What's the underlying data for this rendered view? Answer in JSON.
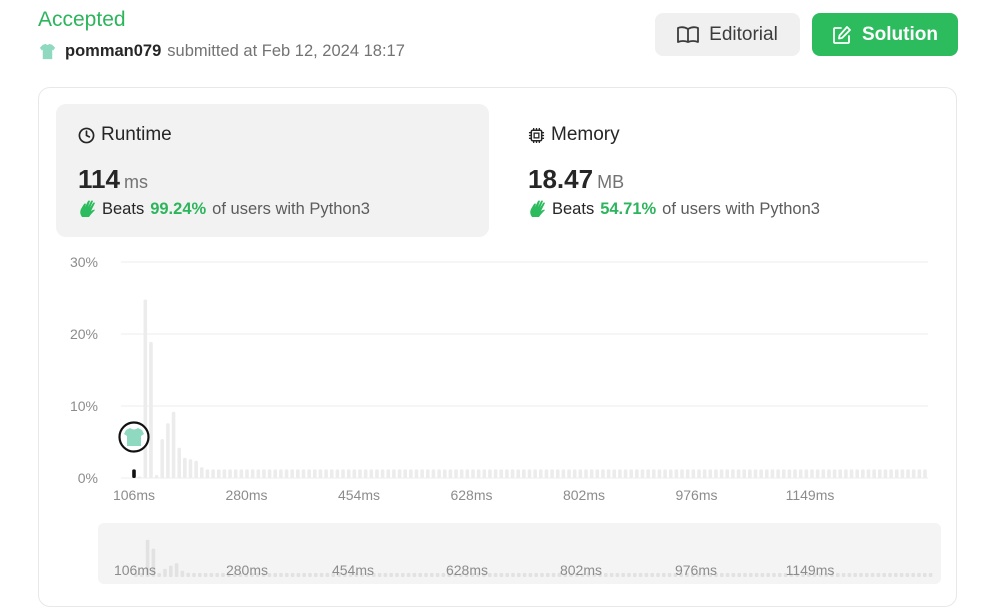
{
  "header": {
    "status": "Accepted",
    "username": "pomman079",
    "submitted_text": "submitted at Feb 12, 2024 18:17",
    "editorial_label": "Editorial",
    "solution_label": "Solution"
  },
  "runtime": {
    "title": "Runtime",
    "value": "114",
    "unit": "ms",
    "beats_label": "Beats",
    "beats_pct": "99.24%",
    "beats_suffix": "of users with Python3"
  },
  "memory": {
    "title": "Memory",
    "value": "18.47",
    "unit": "MB",
    "beats_label": "Beats",
    "beats_pct": "54.71%",
    "beats_suffix": "of users with Python3"
  },
  "colors": {
    "accent_green": "#2cbb5d",
    "bar_gray": "#ececec",
    "marker": "#000000",
    "avatar": "#8fd9c0"
  },
  "chart_data": {
    "type": "bar",
    "title": "",
    "xlabel": "",
    "ylabel": "",
    "ylim": [
      0,
      30
    ],
    "y_ticks": [
      "30%",
      "20%",
      "10%",
      "0%"
    ],
    "x_tick_labels": [
      "106ms",
      "280ms",
      "454ms",
      "628ms",
      "802ms",
      "976ms",
      "1149ms"
    ],
    "x_start_ms": 106,
    "x_step_ms": 5.8,
    "values": [
      1.2,
      0.2,
      24.8,
      18.9,
      0.4,
      5.4,
      7.6,
      9.2,
      4.2,
      2.8,
      2.6,
      2.4,
      1.5,
      1.2,
      1.2,
      1.2,
      1.2,
      1.2,
      1.2,
      1.2,
      1.2,
      1.2,
      1.2,
      1.2,
      1.2,
      1.2,
      1.2,
      1.2,
      1.2,
      1.2,
      1.2,
      1.2,
      1.2,
      1.2,
      1.2,
      1.2,
      1.2,
      1.2,
      1.2,
      1.2,
      1.2,
      1.2,
      1.2,
      1.2,
      1.2,
      1.2,
      1.2,
      1.2,
      1.2,
      1.2,
      1.2,
      1.2,
      1.2,
      1.2,
      1.2,
      1.2,
      1.2,
      1.2,
      1.2,
      1.2,
      1.2,
      1.2,
      1.2,
      1.2,
      1.2,
      1.2,
      1.2,
      1.2,
      1.2,
      1.2,
      1.2,
      1.2,
      1.2,
      1.2,
      1.2,
      1.2,
      1.2,
      1.2,
      1.2,
      1.2,
      1.2,
      1.2,
      1.2,
      1.2,
      1.2,
      1.2,
      1.2,
      1.2,
      1.2,
      1.2,
      1.2,
      1.2,
      1.2,
      1.2,
      1.2,
      1.2,
      1.2,
      1.2,
      1.2,
      1.2,
      1.2,
      1.2,
      1.2,
      1.2,
      1.2,
      1.2,
      1.2,
      1.2,
      1.2,
      1.2,
      1.2,
      1.2,
      1.2,
      1.2,
      1.2,
      1.2,
      1.2,
      1.2,
      1.2,
      1.2,
      1.2,
      1.2,
      1.2,
      1.2,
      1.2,
      1.2,
      1.2,
      1.2,
      1.2,
      1.2,
      1.2,
      1.2,
      1.2,
      1.2,
      1.2,
      1.2,
      1.2,
      1.2,
      1.2,
      1.2,
      1.2,
      1.2,
      1.2,
      1.2,
      1.2,
      1.2,
      1.2,
      1.2,
      1.2,
      1.2,
      1.2,
      1.2,
      1.2,
      1.2,
      1.2,
      1.2,
      1.2,
      1.2,
      1.2,
      1.2,
      1.2,
      1.2,
      1.2,
      1.2,
      1.2,
      1.2,
      1.2,
      1.2,
      1.2,
      1.2,
      1.2,
      1.2,
      1.2,
      1.2,
      1.2,
      1.2,
      1.2,
      1.2,
      1.2,
      1.2,
      1.2,
      1.2,
      1.2,
      1.2,
      1.2,
      1.2,
      1.2,
      1.2,
      1.2,
      1.2
    ],
    "highlight_index": 0,
    "grid": true
  }
}
